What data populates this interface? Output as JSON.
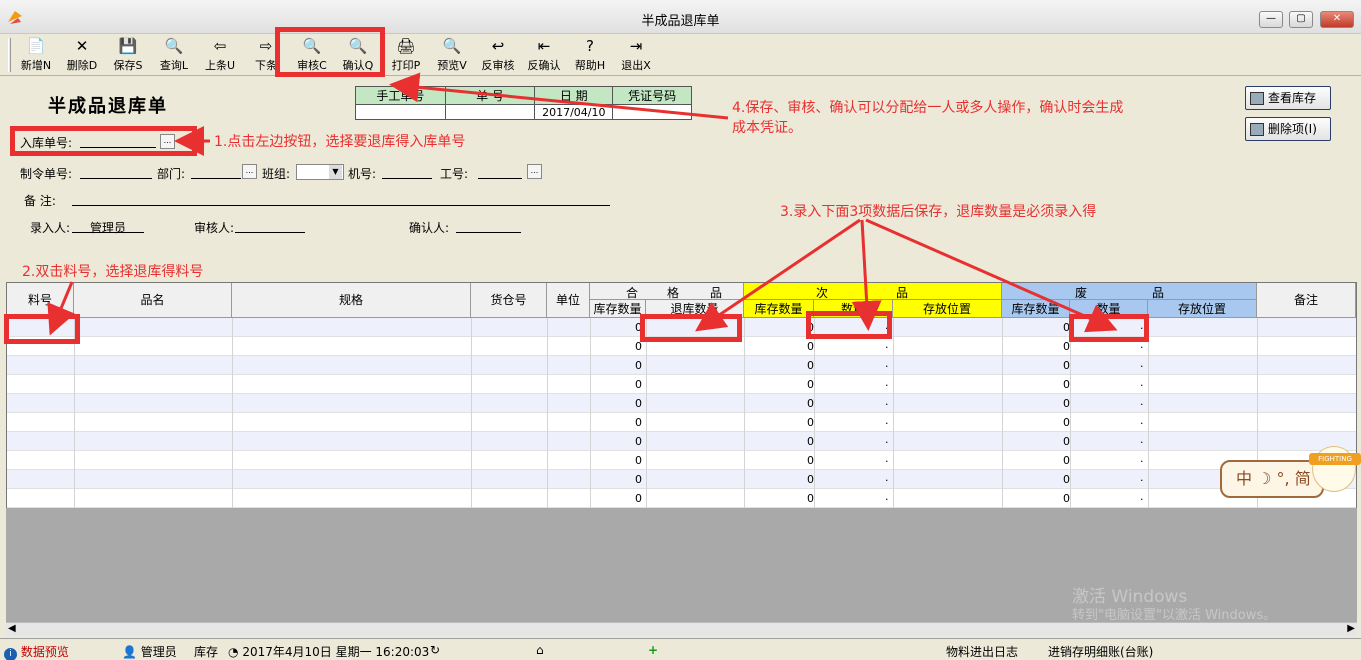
{
  "window": {
    "title": "半成品退库单"
  },
  "toolbar": {
    "buttons": [
      {
        "label": "新增N",
        "icon": "new-doc-icon",
        "glyph": "📄"
      },
      {
        "label": "删除D",
        "icon": "delete-x-icon",
        "glyph": "✕"
      },
      {
        "label": "保存S",
        "icon": "save-disk-icon",
        "glyph": "💾"
      },
      {
        "label": "查询L",
        "icon": "query-icon",
        "glyph": "🔍"
      },
      {
        "label": "上条U",
        "icon": "arrow-left-icon",
        "glyph": "⇦"
      },
      {
        "label": "下条",
        "icon": "arrow-right-icon",
        "glyph": "⇨"
      },
      {
        "label": "审核C",
        "icon": "audit-magnifier-icon",
        "glyph": "🔍"
      },
      {
        "label": "确认Q",
        "icon": "confirm-magnifier-icon",
        "glyph": "🔍"
      },
      {
        "label": "打印P",
        "icon": "printer-icon",
        "glyph": "🖨"
      },
      {
        "label": "预览V",
        "icon": "preview-magnifier-icon",
        "glyph": "🔍"
      },
      {
        "label": "反审核",
        "icon": "unaudit-icon",
        "glyph": "↩"
      },
      {
        "label": "反确认",
        "icon": "unconfirm-icon",
        "glyph": "⇤"
      },
      {
        "label": "帮助H",
        "icon": "help-icon",
        "glyph": "?"
      },
      {
        "label": "退出X",
        "icon": "exit-door-icon",
        "glyph": "⇥"
      }
    ]
  },
  "form": {
    "title": "半成品退库单",
    "voucher_table": {
      "headers": [
        "手工单号",
        "单    号",
        "日    期",
        "凭证号码"
      ],
      "values": [
        "",
        "",
        "2017/04/10",
        ""
      ]
    },
    "in_order_label": "入库单号:",
    "order_no_label": "制令单号:",
    "dept_label": "部门:",
    "team_label": "班组:",
    "machine_label": "机号:",
    "worker_label": "工号:",
    "remark_label": "备    注:",
    "entered_by_label": "录入人:",
    "entered_by_value": "管理员",
    "auditor_label": "审核人:",
    "confirmer_label": "确认人:"
  },
  "side_buttons": {
    "view_stock": "查看库存",
    "delete_item": "删除项(I)"
  },
  "annotations": {
    "a1": "1.点击左边按钮，选择要退库得入库单号",
    "a2": "2.双击料号，选择退库得料号",
    "a3": "3.录入下面3项数据后保存，退库数量是必须录入得",
    "a4_line1": "4.保存、审核、确认可以分配给一人或多人操作，确认时会生成",
    "a4_line2": "成本凭证。"
  },
  "grid": {
    "headers": {
      "part_no": "料号",
      "name": "品名",
      "spec": "规格",
      "location": "货仓号",
      "unit": "单位",
      "good_1": "合",
      "good_2": "格",
      "good_3": "品",
      "good_stock": "库存数量",
      "good_return": "退库数量",
      "second_1": "次",
      "second_2": "品",
      "second_stock": "库存数量",
      "second_qty": "数量",
      "second_pos": "存放位置",
      "scrap_1": "废",
      "scrap_2": "品",
      "scrap_stock": "库存数量",
      "scrap_qty": "数量",
      "scrap_pos": "存放位置",
      "remark": "备注"
    },
    "zero_value": "0",
    "row_count": 10,
    "header_colors": {
      "second": "#ffff00",
      "scrap": "#a8c8f0"
    }
  },
  "statusbar": {
    "data_preview": "数据预览",
    "user": "管理员",
    "module": "库存",
    "datetime": "2017年4月10日 星期一 16:20:03",
    "log": "物料进出日志",
    "ledger": "进销存明细账(台账)"
  },
  "watermark": {
    "line1": "激活 Windows",
    "line2": "转到\"电脑设置\"以激活 Windows。"
  },
  "input_method": {
    "label": "中 ☽ °, 简",
    "badge": "FIGHTING"
  }
}
